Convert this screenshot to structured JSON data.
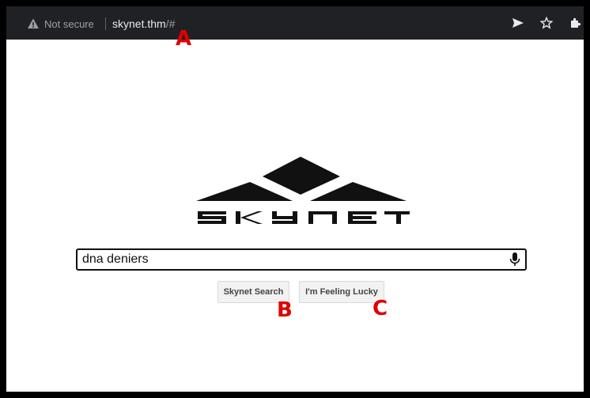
{
  "browser": {
    "security_label": "Not secure",
    "url_host": "skynet.thm",
    "url_path": "/#",
    "icons": [
      "warning-triangle-icon",
      "send-icon",
      "star-icon",
      "extensions-puzzle-icon"
    ]
  },
  "annotations": {
    "a": "A",
    "b": "B",
    "c": "C",
    "color": "#e00000"
  },
  "search": {
    "value": "dna deniers",
    "placeholder": ""
  },
  "buttons": {
    "search_label": "Skynet Search",
    "lucky_label": "I'm Feeling Lucky"
  },
  "logo_alt": "SKYNET"
}
